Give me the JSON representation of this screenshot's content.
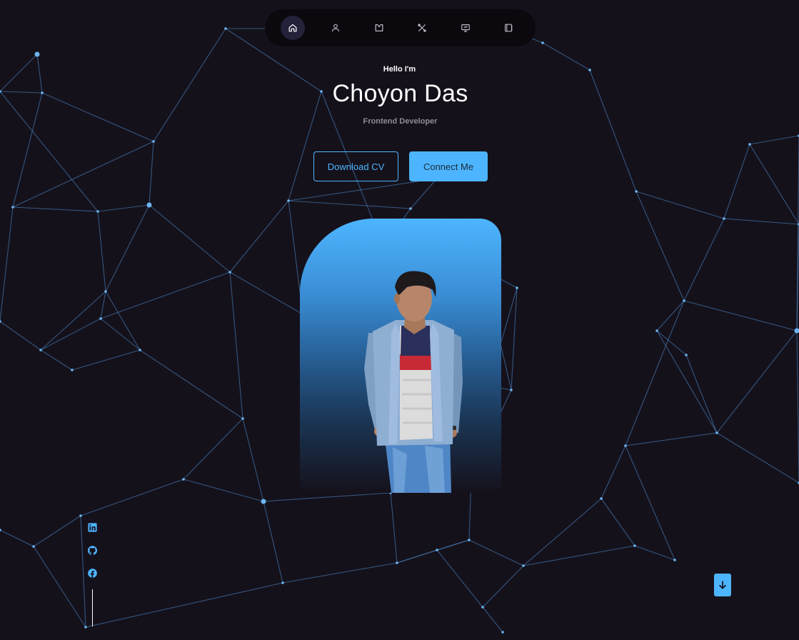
{
  "nav": {
    "items": [
      {
        "icon": "home-icon",
        "active": true
      },
      {
        "icon": "user-icon",
        "active": false
      },
      {
        "icon": "book-icon",
        "active": false
      },
      {
        "icon": "tools-icon",
        "active": false
      },
      {
        "icon": "monitor-icon",
        "active": false
      },
      {
        "icon": "contact-book-icon",
        "active": false
      }
    ]
  },
  "hero": {
    "greeting": "Hello I'm",
    "name": "Choyon Das",
    "role": "Frontend Developer",
    "download_label": "Download CV",
    "connect_label": "Connect Me"
  },
  "socials": [
    {
      "icon": "linkedin-icon"
    },
    {
      "icon": "github-icon"
    },
    {
      "icon": "facebook-icon"
    }
  ],
  "colors": {
    "accent": "#4db5ff",
    "background": "#15111b",
    "nav_bg": "#0b090e",
    "nav_active": "#24213a",
    "muted_text": "#8e8c93"
  }
}
